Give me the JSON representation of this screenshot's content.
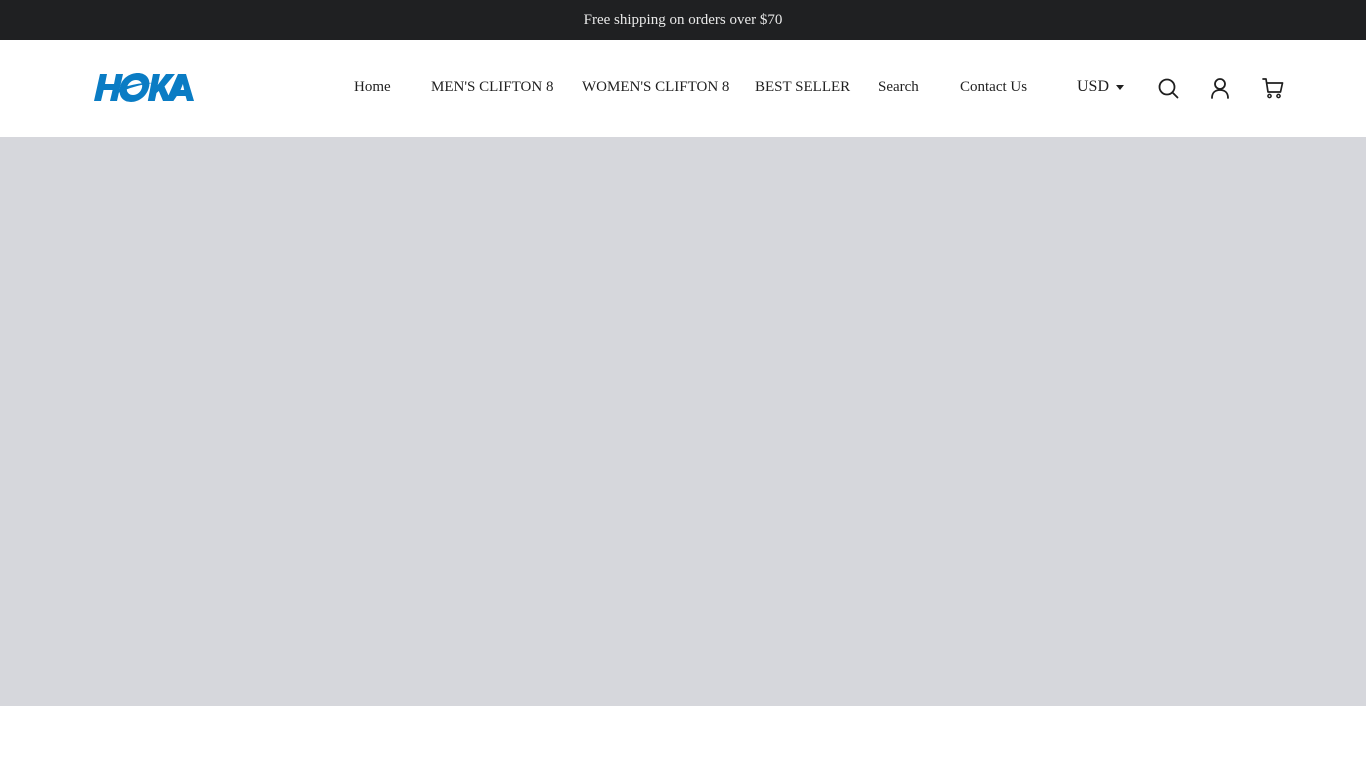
{
  "announcement": {
    "text": "Free shipping on orders over $70"
  },
  "header": {
    "logo_text": "HOKA",
    "nav": [
      {
        "label": "Home"
      },
      {
        "label": "MEN'S CLIFTON 8"
      },
      {
        "label": "WOMEN'S CLIFTON 8"
      },
      {
        "label": "BEST SELLER"
      },
      {
        "label": "Search"
      },
      {
        "label": "Contact Us"
      }
    ],
    "currency": {
      "selected": "USD"
    },
    "icons": {
      "search": "search-icon",
      "account": "user-icon",
      "cart": "cart-icon"
    }
  },
  "colors": {
    "announcement_bg": "#1f2022",
    "brand_blue": "#0a7cc4",
    "hero_bg": "#d6d7dc",
    "text": "#1f1f1f"
  }
}
